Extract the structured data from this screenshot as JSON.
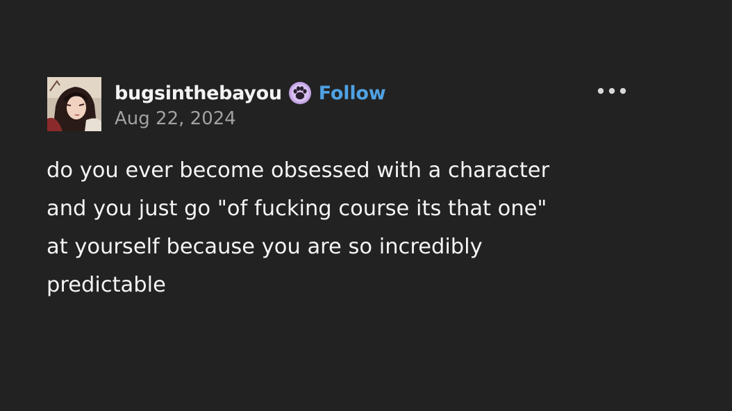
{
  "post": {
    "author": {
      "username": "bugsinthebayou",
      "avatar_icon": "avatar-image",
      "badge_icon": "paw-badge-icon"
    },
    "follow_label": "Follow",
    "date": "Aug 22, 2024",
    "more_icon": "more-options-icon",
    "body": "do you ever become obsessed with a character\nand you just go \"of fucking course its that one\"\nat yourself because you are so incredibly\npredictable"
  },
  "colors": {
    "background": "#222222",
    "text": "#f4f4f4",
    "muted_text": "#a2a2a2",
    "follow_link": "#4fa2e3",
    "badge": "#c7a6e8"
  }
}
